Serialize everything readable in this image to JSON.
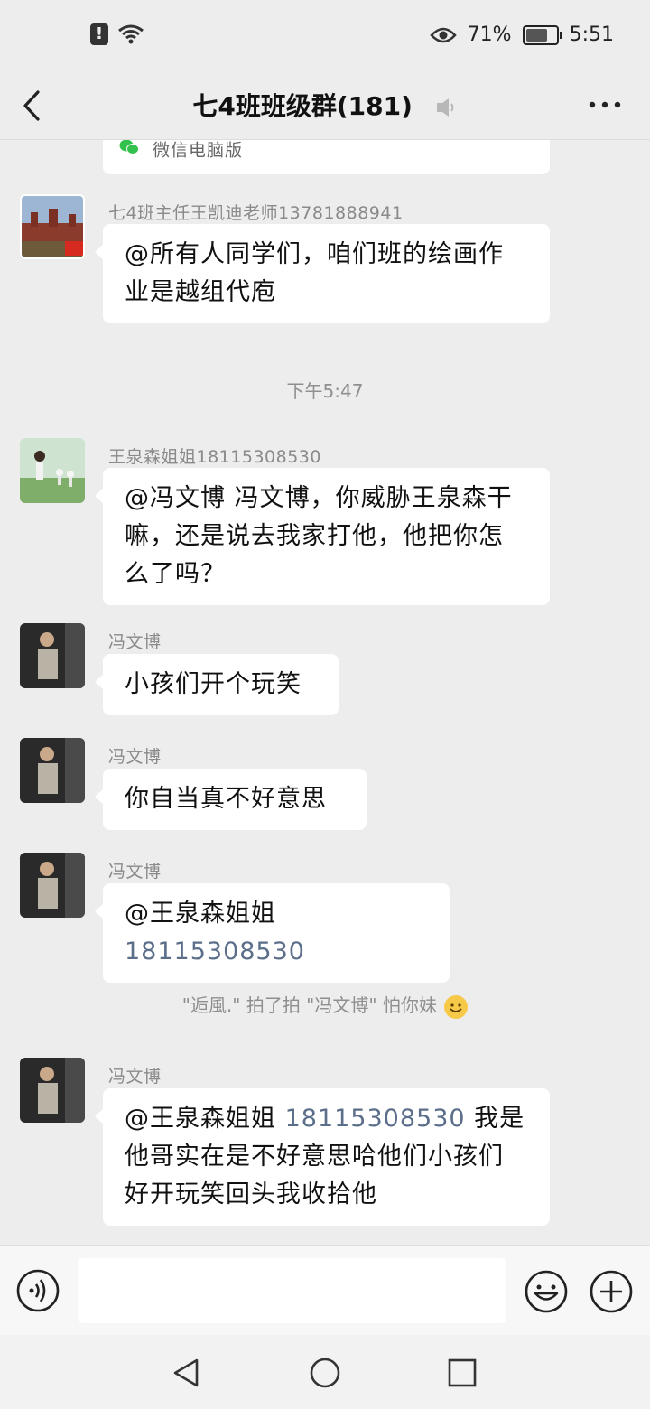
{
  "status_bar": {
    "alert_icon_text": "!",
    "battery_percent": "71%",
    "battery_level": 0.71,
    "time": "5:51"
  },
  "header": {
    "title": "七4班班级群(181)"
  },
  "messages": {
    "m0": {
      "source": "微信电脑版"
    },
    "m1": {
      "sender": "七4班主任王凯迪老师13781888941",
      "text": "@所有人同学们，咱们班的绘画作业是越组代庖"
    },
    "time_sep": "下午5:47",
    "m2": {
      "sender": "王泉森姐姐18115308530",
      "text": "@冯文博  冯文博，你威胁王泉森干嘛，还是说去我家打他，他把你怎么了吗？"
    },
    "m3": {
      "sender": "冯文博",
      "text": "小孩们开个玩笑"
    },
    "m4": {
      "sender": "冯文博",
      "text": "你自当真不好意思"
    },
    "m5": {
      "sender": "冯文博",
      "mention": "@王泉森姐姐",
      "number": "18115308530"
    },
    "pat": {
      "text": "\"逅風.\" 拍了拍 \"冯文博\" 怕你妹"
    },
    "m6": {
      "sender": "冯文博",
      "mention": "@王泉森姐姐",
      "number": "18115308530",
      "text": "我是他哥实在是不好意思哈他们小孩们好开玩笑回头我收拾他"
    }
  },
  "input": {
    "placeholder": ""
  },
  "icons": {
    "back": "back-arrow-icon",
    "more": "more-dots-icon",
    "mute": "mute-icon",
    "voice": "voice-input-icon",
    "emoji": "emoji-icon",
    "plus": "plus-icon",
    "wechat": "wechat-logo-icon",
    "nav_back": "nav-back-triangle-icon",
    "nav_home": "nav-home-circle-icon",
    "nav_recent": "nav-recent-square-icon"
  },
  "colors": {
    "background": "#ededed",
    "bubble": "#ffffff",
    "mention_number": "#5b6e8a",
    "wechat_green": "#33c24d"
  }
}
